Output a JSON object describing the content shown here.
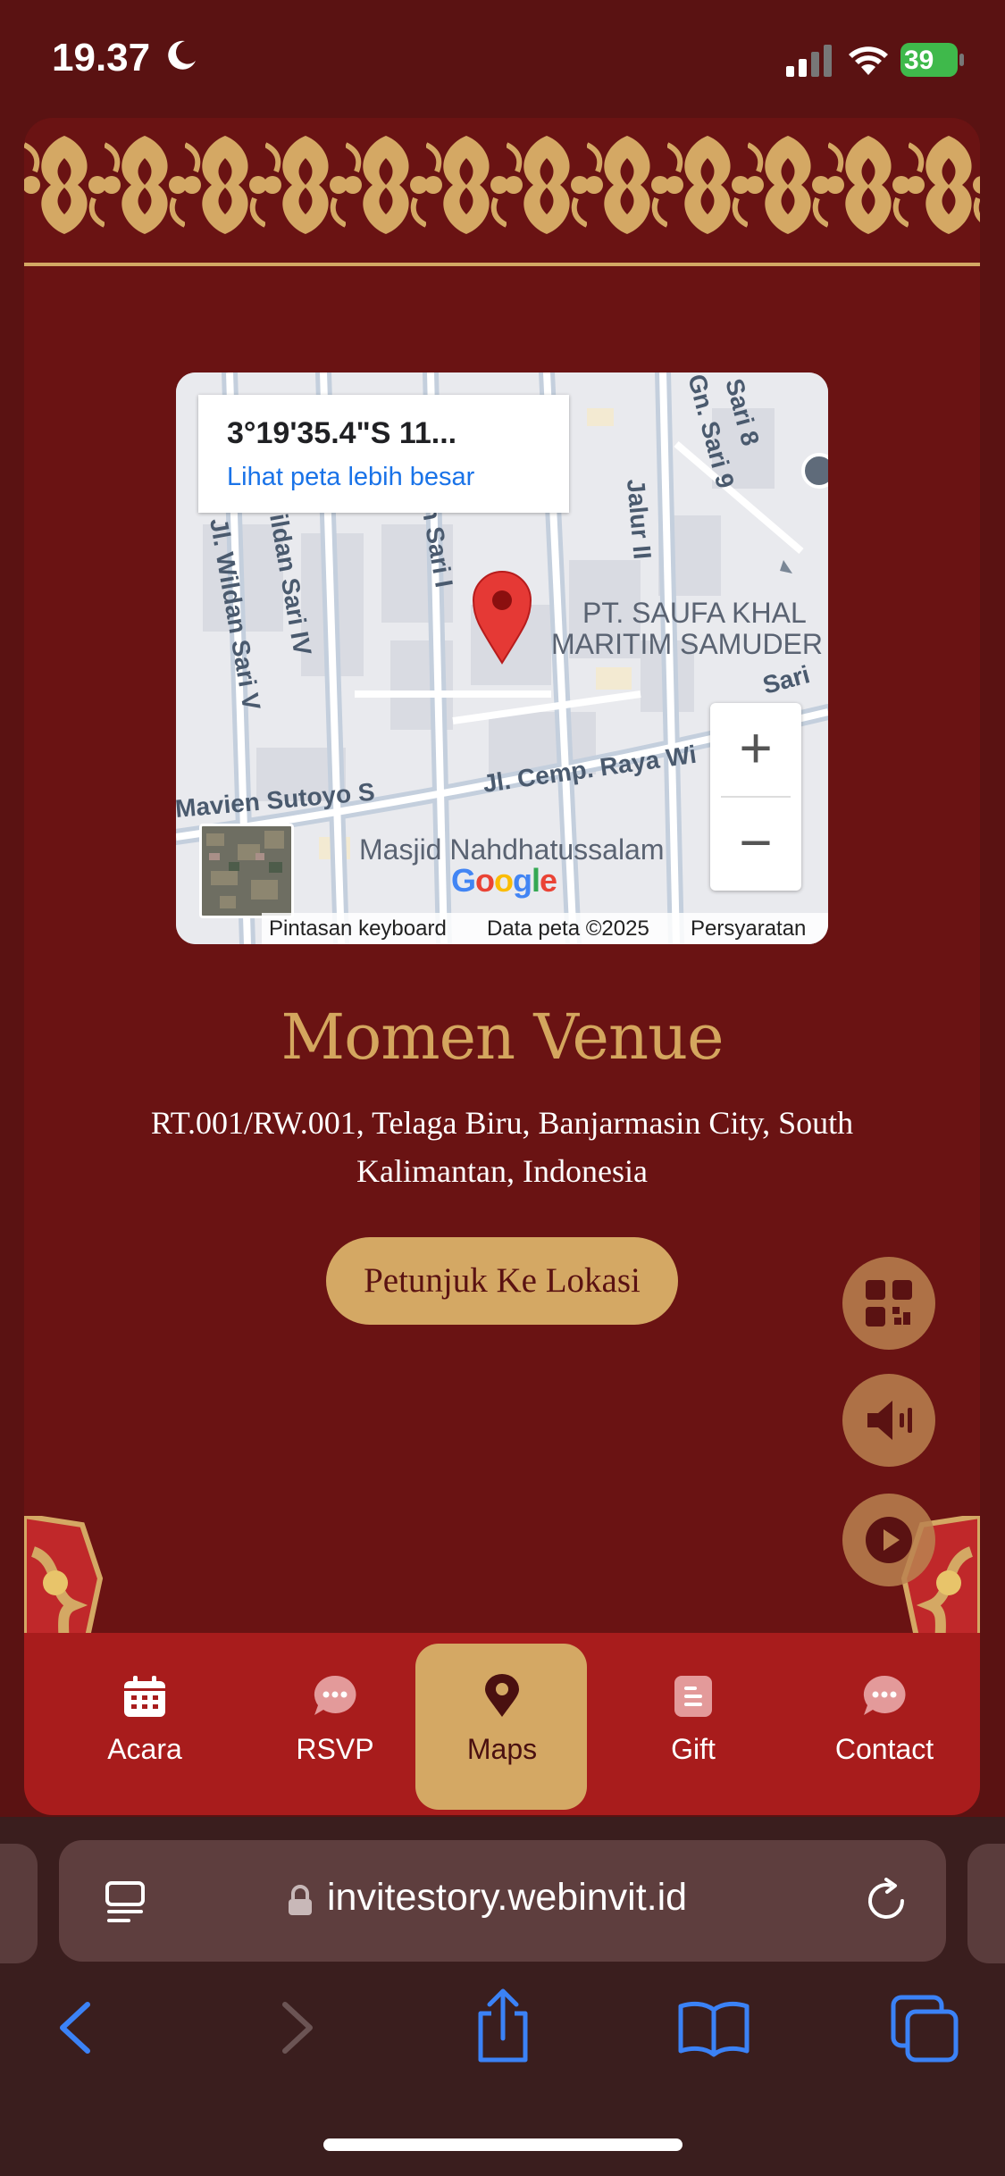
{
  "status_bar": {
    "time": "19.37",
    "battery": "39"
  },
  "map": {
    "coordinates": "3°19'35.4\"S 11...",
    "larger_map_link": "Lihat peta lebih besar",
    "zoom_in": "+",
    "zoom_out": "−",
    "google_logo": "Google",
    "attribution": {
      "shortcuts": "Pintasan keyboard",
      "data": "Data peta ©2025",
      "terms": "Persyaratan"
    },
    "street_labels": [
      "Jl. Wildan Sari V",
      "Wildan Sari IV",
      "n Sari I",
      "Jalur II",
      "Gn. Sari 9",
      "Sari 8",
      "PT. SAUFA KHAL",
      "MARITIM SAMUDER",
      "Mavien Sutoyo S",
      "Jl. Cemp. Raya Wi",
      "Masjid Nahdhatussalam",
      "Sari"
    ]
  },
  "venue": {
    "title": "Momen Venue",
    "address": "RT.001/RW.001, Telaga Biru, Banjarmasin City, South Kalimantan, Indonesia",
    "directions_button": "Petunjuk Ke Lokasi"
  },
  "colors": {
    "background": "#6a1313",
    "gold": "#d4a864",
    "nav": "#a81c1c"
  },
  "fabs": [
    {
      "name": "qr-code-icon"
    },
    {
      "name": "speaker-icon"
    },
    {
      "name": "play-icon"
    }
  ],
  "bottom_nav": [
    {
      "label": "Acara",
      "icon": "calendar-icon",
      "active": false
    },
    {
      "label": "RSVP",
      "icon": "chat-icon",
      "active": false
    },
    {
      "label": "Maps",
      "icon": "map-pin-icon",
      "active": true
    },
    {
      "label": "Gift",
      "icon": "gift-icon",
      "active": false
    },
    {
      "label": "Contact",
      "icon": "chat-icon",
      "active": false
    }
  ],
  "browser": {
    "url": "invitestory.webinvit.id"
  }
}
